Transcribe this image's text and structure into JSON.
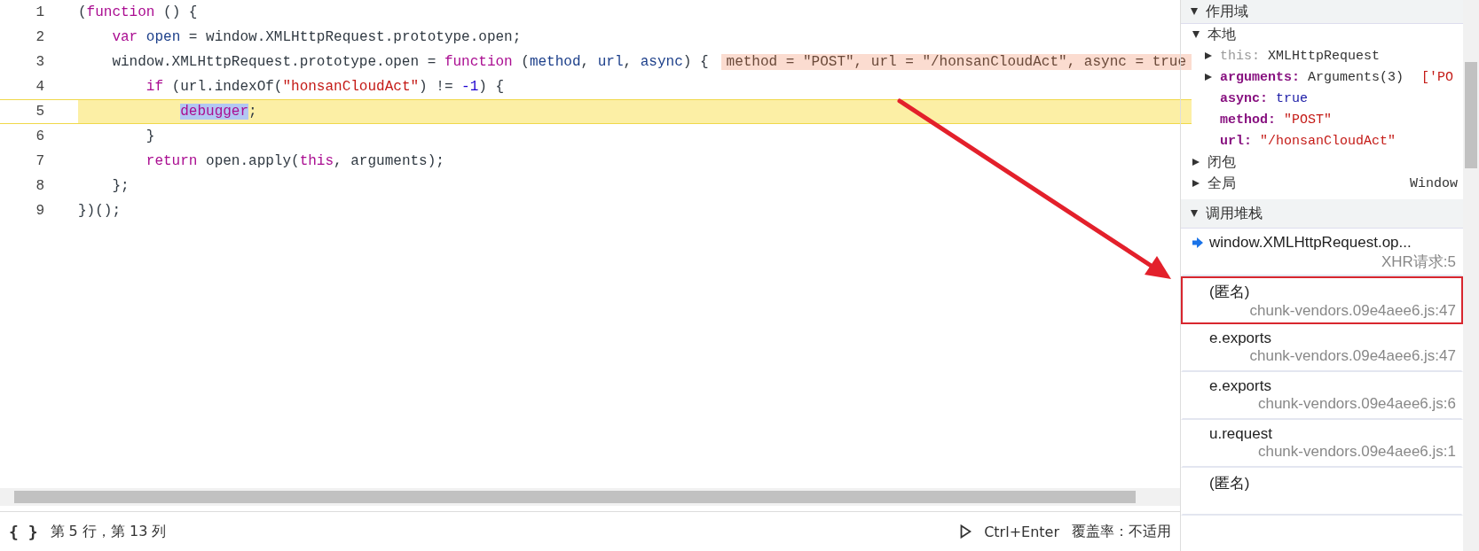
{
  "editor": {
    "lines": [
      {
        "number": "1",
        "current": false,
        "tokens": [
          {
            "kind": "plain",
            "text": "("
          },
          {
            "kind": "keyword",
            "text": "function"
          },
          {
            "kind": "plain",
            "text": " () {"
          }
        ]
      },
      {
        "number": "2",
        "current": false,
        "tokens": [
          {
            "kind": "keyword",
            "text": "    var"
          },
          {
            "kind": "variable",
            "text": " open"
          },
          {
            "kind": "plain",
            "text": " = window.XMLHttpRequest.prototype.open;"
          }
        ]
      },
      {
        "number": "3",
        "current": false,
        "tokens": [
          {
            "kind": "plain",
            "text": "    window.XMLHttpRequest.prototype.open = "
          },
          {
            "kind": "keyword",
            "text": "function"
          },
          {
            "kind": "plain",
            "text": " ("
          },
          {
            "kind": "variable",
            "text": "method"
          },
          {
            "kind": "plain",
            "text": ", "
          },
          {
            "kind": "variable",
            "text": "url"
          },
          {
            "kind": "plain",
            "text": ", "
          },
          {
            "kind": "variable",
            "text": "async"
          },
          {
            "kind": "plain",
            "text": ") {"
          }
        ],
        "inline_value": "method = \"POST\", url = \"/honsanCloudAct\", async = true"
      },
      {
        "number": "4",
        "current": false,
        "tokens": [
          {
            "kind": "keyword",
            "text": "        if"
          },
          {
            "kind": "plain",
            "text": " (url.indexOf("
          },
          {
            "kind": "string",
            "text": "\"honsanCloudAct\""
          },
          {
            "kind": "plain",
            "text": ") != "
          },
          {
            "kind": "number",
            "text": "-1"
          },
          {
            "kind": "plain",
            "text": ") {"
          }
        ]
      },
      {
        "number": "5",
        "current": true,
        "tokens": [
          {
            "kind": "keyword",
            "text": "            debugger",
            "selected": true
          },
          {
            "kind": "plain",
            "text": ";"
          }
        ]
      },
      {
        "number": "6",
        "current": false,
        "tokens": [
          {
            "kind": "plain",
            "text": "        }"
          }
        ]
      },
      {
        "number": "7",
        "current": false,
        "tokens": [
          {
            "kind": "keyword",
            "text": "        return"
          },
          {
            "kind": "plain",
            "text": " open.apply("
          },
          {
            "kind": "keyword",
            "text": "this"
          },
          {
            "kind": "plain",
            "text": ", arguments);"
          }
        ]
      },
      {
        "number": "8",
        "current": false,
        "tokens": [
          {
            "kind": "plain",
            "text": "    };"
          }
        ]
      },
      {
        "number": "9",
        "current": false,
        "tokens": [
          {
            "kind": "plain",
            "text": "})();"
          }
        ]
      }
    ]
  },
  "status_bar": {
    "format_button": "{ }",
    "cursor": "第 5 行，第 13 列",
    "run_shortcut": "Ctrl+Enter",
    "coverage": "覆盖率：不适用"
  },
  "scope": {
    "title": "作用域",
    "expanded": true,
    "groups": [
      {
        "name": "本地",
        "expanded": true,
        "items": [
          {
            "name": "this:",
            "dim": true,
            "expandable": true,
            "kind": "object",
            "value": "XMLHttpRequest"
          },
          {
            "name": "arguments:",
            "dim": false,
            "expandable": true,
            "kind": "object",
            "value": "Arguments(3)",
            "preview": "['PO"
          },
          {
            "name": "async:",
            "dim": false,
            "expandable": false,
            "kind": "boolean",
            "value": "true"
          },
          {
            "name": "method:",
            "dim": false,
            "expandable": false,
            "kind": "string",
            "value": "\"POST\""
          },
          {
            "name": "url:",
            "dim": false,
            "expandable": false,
            "kind": "string",
            "value": "\"/honsanCloudAct\""
          }
        ]
      },
      {
        "name": "闭包",
        "expanded": false
      },
      {
        "name": "全局",
        "expanded": false,
        "value": "Window"
      }
    ]
  },
  "call_stack": {
    "title": "调用堆栈",
    "expanded": true,
    "frames": [
      {
        "function": "window.XMLHttpRequest.op...",
        "location": "XHR请求:5",
        "current": true,
        "annotated": false
      },
      {
        "function": "(匿名)",
        "location": "chunk-vendors.09e4aee6.js:47",
        "current": false,
        "annotated": true
      },
      {
        "function": "e.exports",
        "location": "chunk-vendors.09e4aee6.js:47",
        "current": false,
        "annotated": false
      },
      {
        "function": "e.exports",
        "location": "chunk-vendors.09e4aee6.js:6",
        "current": false,
        "annotated": false
      },
      {
        "function": "u.request",
        "location": "chunk-vendors.09e4aee6.js:1",
        "current": false,
        "annotated": false
      },
      {
        "function": "(匿名)",
        "current": false,
        "annotated": false
      }
    ]
  }
}
